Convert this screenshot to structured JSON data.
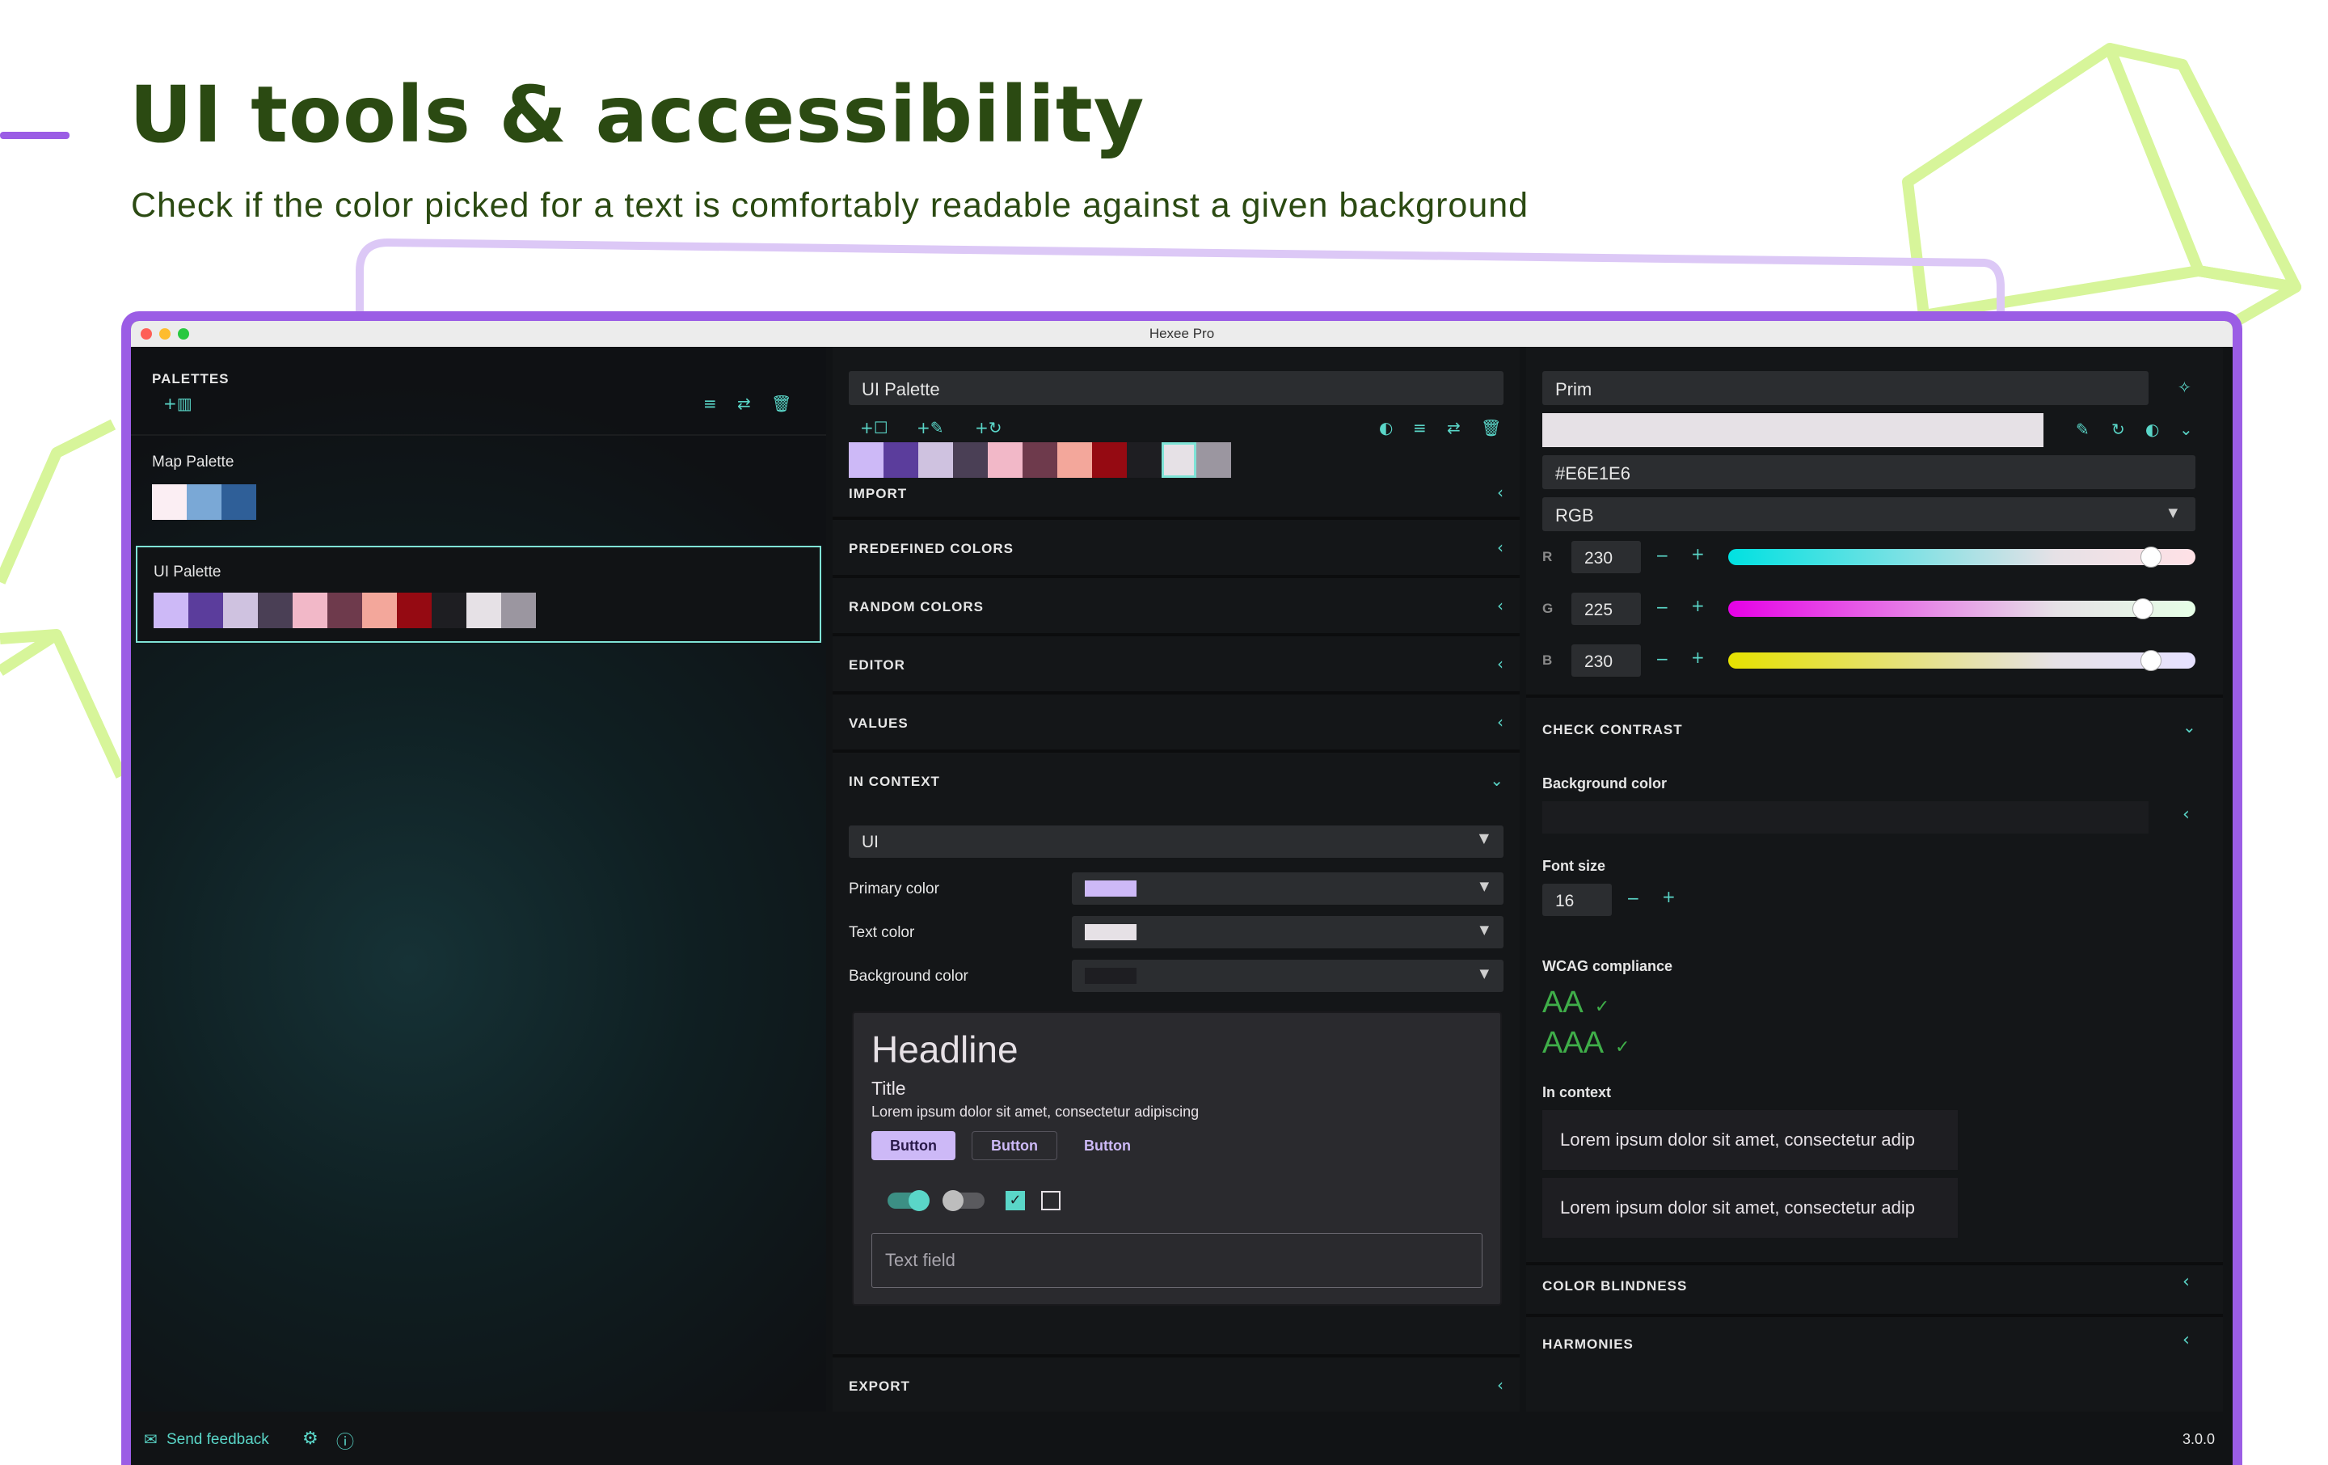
{
  "hero": {
    "title": "UI tools & accessibility",
    "subtitle": "Check if the color picked for a text is comfortably readable against a given background"
  },
  "colors": {
    "accent_purple": "#9b5de5",
    "deco_green": "#d7f59a",
    "teal": "#5ad6c8",
    "hero_text": "#2b4a12"
  },
  "window": {
    "title": "Hexee Pro"
  },
  "palettes": {
    "header": "PALETTES",
    "icons": [
      "add-grid-icon",
      "sort-icon",
      "swap-icon",
      "trash-icon"
    ],
    "items": [
      {
        "name": "Map Palette",
        "swatches": [
          "#fbeef3",
          "#7aa8d6",
          "#2f5f98"
        ]
      },
      {
        "name": "UI Palette",
        "swatches": [
          "#cdb9f7",
          "#5b3d9c",
          "#cfc2e0",
          "#4a3f55",
          "#f2b8c8",
          "#6e3a4c",
          "#f3a79b",
          "#950a12",
          "#1e1e22",
          "#e6e1e6",
          "#9b96a0"
        ]
      }
    ]
  },
  "middle": {
    "palette_name": "UI Palette",
    "toolbar_icons": [
      "add-square-icon",
      "add-picker-icon",
      "add-refresh-icon",
      "contrast-icon",
      "sort-icon",
      "swap-icon",
      "trash-icon"
    ],
    "swatches": [
      "#cdb9f7",
      "#5b3d9c",
      "#cfc2e0",
      "#4a3f55",
      "#f2b8c8",
      "#6e3a4c",
      "#f3a79b",
      "#950a12",
      "#1e1e22",
      "#e6e1e6",
      "#9b96a0"
    ],
    "sections": [
      "IMPORT",
      "PREDEFINED COLORS",
      "RANDOM COLORS",
      "EDITOR",
      "VALUES",
      "IN CONTEXT"
    ],
    "context": {
      "select_value": "UI",
      "rows": [
        {
          "label": "Primary color",
          "color": "#cdb9f7"
        },
        {
          "label": "Text color",
          "color": "#e6e1e6"
        },
        {
          "label": "Background color",
          "color": "#1e1e22"
        }
      ],
      "preview": {
        "headline": "Headline",
        "title": "Title",
        "body": "Lorem ipsum dolor sit amet, consectetur adipiscing",
        "buttons": [
          "Button",
          "Button",
          "Button"
        ],
        "text_field": "Text field"
      }
    },
    "export": "EXPORT"
  },
  "right": {
    "color_name": "Prim",
    "hex": "#E6E1E6",
    "preview_color": "#e6e1e6",
    "mode": "RGB",
    "channels": [
      {
        "label": "R",
        "value": "230",
        "level": 0.9
      },
      {
        "label": "G",
        "value": "225",
        "level": 0.88
      },
      {
        "label": "B",
        "value": "230",
        "level": 0.9
      }
    ],
    "check_contrast": {
      "header": "CHECK CONTRAST",
      "bg_label": "Background color",
      "font_label": "Font size",
      "font_value": "16",
      "wcag_label": "WCAG compliance",
      "aa": "AA",
      "aaa": "AAA",
      "context_label": "In context",
      "samples": [
        "Lorem ipsum dolor sit amet, consectetur adip",
        "Lorem ipsum dolor sit amet, consectetur adip"
      ]
    },
    "sections": [
      "COLOR BLINDNESS",
      "HARMONIES"
    ]
  },
  "footer": {
    "feedback": "Send feedback",
    "version": "3.0.0"
  }
}
